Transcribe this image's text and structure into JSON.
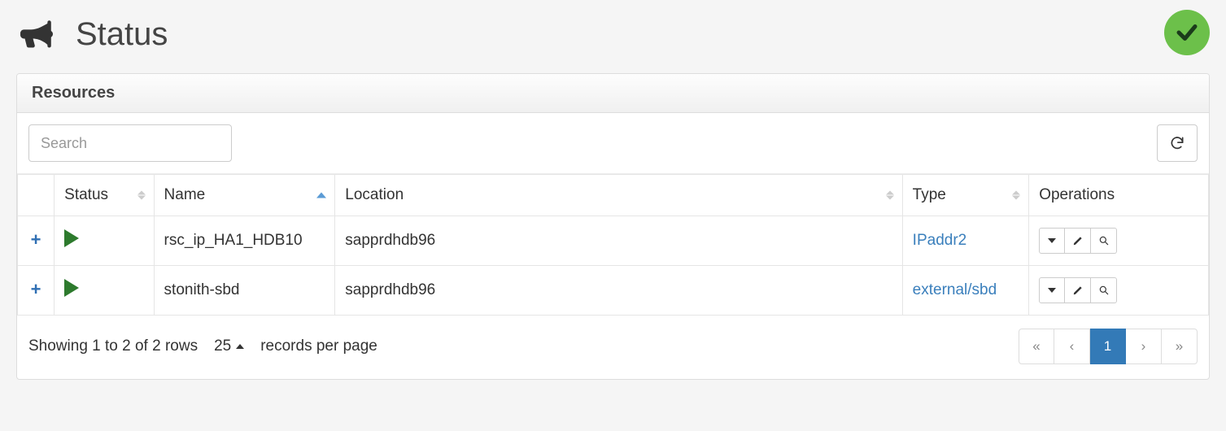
{
  "header": {
    "title": "Status"
  },
  "panel": {
    "title": "Resources"
  },
  "toolbar": {
    "search_placeholder": "Search"
  },
  "table": {
    "columns": {
      "status": "Status",
      "name": "Name",
      "location": "Location",
      "type": "Type",
      "operations": "Operations"
    },
    "rows": [
      {
        "name": "rsc_ip_HA1_HDB10",
        "location": "sapprdhdb96",
        "type": "IPaddr2"
      },
      {
        "name": "stonith-sbd",
        "location": "sapprdhdb96",
        "type": "external/sbd"
      }
    ]
  },
  "footer": {
    "showing": "Showing 1 to 2 of 2 rows",
    "page_size": "25",
    "records_label": "records per page"
  },
  "pagination": {
    "first": "«",
    "prev": "‹",
    "current": "1",
    "next": "›",
    "last": "»"
  }
}
